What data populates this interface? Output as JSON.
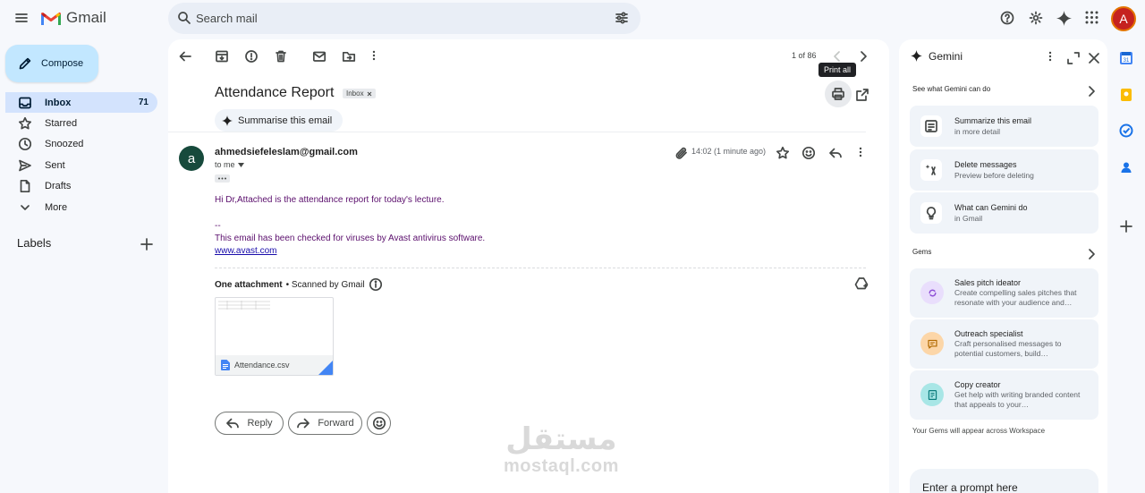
{
  "app": {
    "name": "Gmail"
  },
  "search": {
    "placeholder": "Search mail"
  },
  "user": {
    "initial": "A"
  },
  "sidebar": {
    "compose_label": "Compose",
    "items": [
      {
        "label": "Inbox",
        "count": "71",
        "icon": "inbox-icon"
      },
      {
        "label": "Starred",
        "count": "",
        "icon": "star-icon"
      },
      {
        "label": "Snoozed",
        "count": "",
        "icon": "clock-icon"
      },
      {
        "label": "Sent",
        "count": "",
        "icon": "send-icon"
      },
      {
        "label": "Drafts",
        "count": "",
        "icon": "draft-icon"
      },
      {
        "label": "More",
        "count": "",
        "icon": "chevron-down-icon"
      }
    ],
    "labels_title": "Labels"
  },
  "toolbar": {
    "page_count": "1 of 86",
    "tooltip": "Print all"
  },
  "email": {
    "subject": "Attendance Report",
    "label_chip": "Inbox",
    "summarise_label": "Summarise this email",
    "sender_initial": "a",
    "sender": "ahmedsiefeleslam@gmail.com",
    "to": "to me",
    "time": "14:02 (1 minute ago)",
    "body_line1": "Hi Dr,Attached is the attendance report for today's lecture.",
    "body_sep": "--",
    "body_line2": "This email has been checked for viruses by Avast antivirus software.",
    "body_link": "www.avast.com",
    "attachment_count_label": "One attachment",
    "scanned_label": "• Scanned by Gmail",
    "attachment_name": "Attendance.csv",
    "reply_label": "Reply",
    "forward_label": "Forward"
  },
  "watermark": {
    "arabic": "مستقل",
    "latin": "mostaql.com"
  },
  "gemini": {
    "title": "Gemini",
    "section1": "See what Gemini can do",
    "cards": [
      {
        "title": "Summarize this email",
        "sub": "in more detail",
        "icon": "summarize-icon"
      },
      {
        "title": "Delete messages",
        "sub": "Preview before deleting",
        "icon": "delete-sparkle-icon"
      },
      {
        "title": "What can Gemini do",
        "sub": "in Gmail",
        "icon": "lightbulb-icon"
      }
    ],
    "section2": "Gems",
    "gems": [
      {
        "title": "Sales pitch ideator",
        "sub": "Create compelling sales pitches that resonate with your audience and…",
        "color": "#e9defc",
        "fg": "#8e4fd6"
      },
      {
        "title": "Outreach specialist",
        "sub": "Craft personalised messages to potential customers, build…",
        "color": "#fcd6a8",
        "fg": "#b26a00"
      },
      {
        "title": "Copy creator",
        "sub": "Get help with writing branded content that appeals to your…",
        "color": "#a8e6e6",
        "fg": "#0b7d7d"
      }
    ],
    "gems_footer": "Your Gems will appear across Workspace",
    "prompt_placeholder": "Enter a prompt here"
  }
}
